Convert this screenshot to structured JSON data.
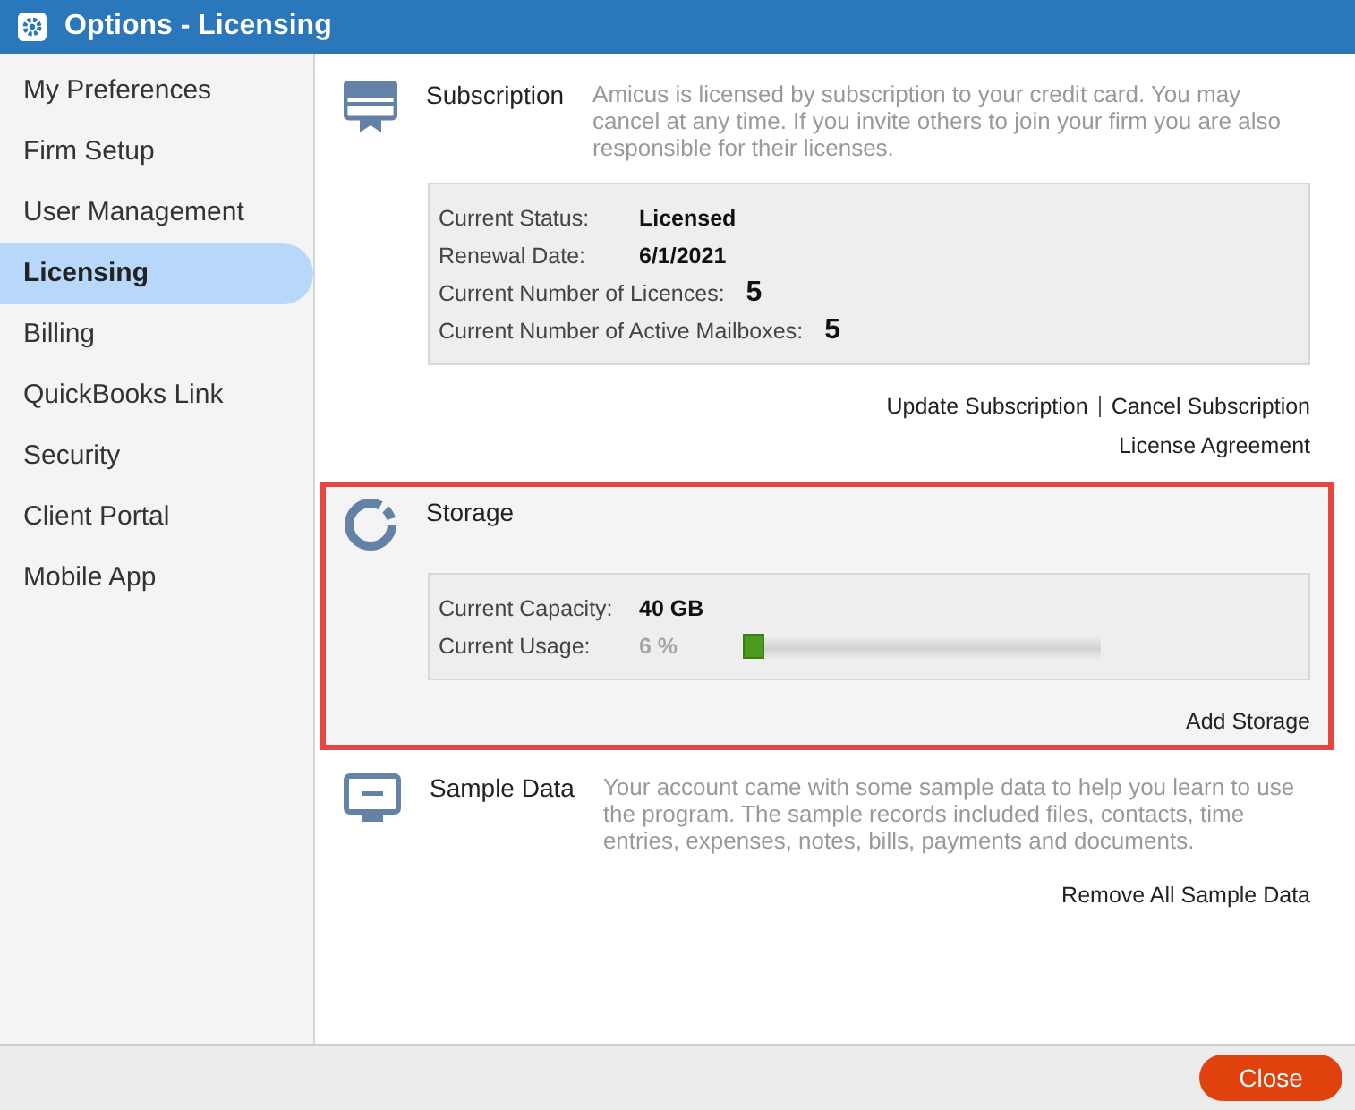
{
  "window": {
    "title": "Options - Licensing"
  },
  "sidebar": {
    "items": [
      {
        "label": "My Preferences",
        "selected": false
      },
      {
        "label": "Firm Setup",
        "selected": false
      },
      {
        "label": "User Management",
        "selected": false
      },
      {
        "label": "Licensing",
        "selected": true
      },
      {
        "label": "Billing",
        "selected": false
      },
      {
        "label": "QuickBooks Link",
        "selected": false
      },
      {
        "label": "Security",
        "selected": false
      },
      {
        "label": "Client Portal",
        "selected": false
      },
      {
        "label": "Mobile App",
        "selected": false
      }
    ]
  },
  "sections": [
    {
      "kind": "subscription",
      "title": "Subscription",
      "highlighted": false,
      "description": "Amicus is licensed by subscription to your credit card. You may cancel at any time. If you invite others to join your firm you are also responsible for their licenses.",
      "details": [
        {
          "label": "Current Status:",
          "value": "Licensed",
          "kind": "normal"
        },
        {
          "label": "Renewal Date:",
          "value": "6/1/2021",
          "kind": "normal"
        },
        {
          "label": "Current Number of Licences:",
          "value": "5",
          "kind": "large"
        },
        {
          "label": "Current Number of Active Mailboxes:",
          "value": "5",
          "kind": "large"
        }
      ],
      "links": [
        [
          "Update Subscription",
          "Cancel Subscription"
        ],
        [
          "License Agreement"
        ]
      ]
    },
    {
      "kind": "storage",
      "title": "Storage",
      "highlighted": true,
      "details": [
        {
          "label": "Current Capacity:",
          "value": "40 GB",
          "kind": "normal"
        },
        {
          "label": "Current Usage:",
          "value": "6 %",
          "kind": "muted",
          "level": 0.06
        }
      ],
      "links": [
        [
          "Add Storage"
        ]
      ]
    },
    {
      "kind": "sample",
      "title": "Sample Data",
      "highlighted": false,
      "description": "Your account came with some sample data to help you learn to use the program. The sample records included files, contacts, time entries, expenses, notes, bills, payments and documents.",
      "links": [
        [
          "Remove All Sample Data"
        ]
      ]
    }
  ],
  "footer": {
    "button": "Close"
  }
}
